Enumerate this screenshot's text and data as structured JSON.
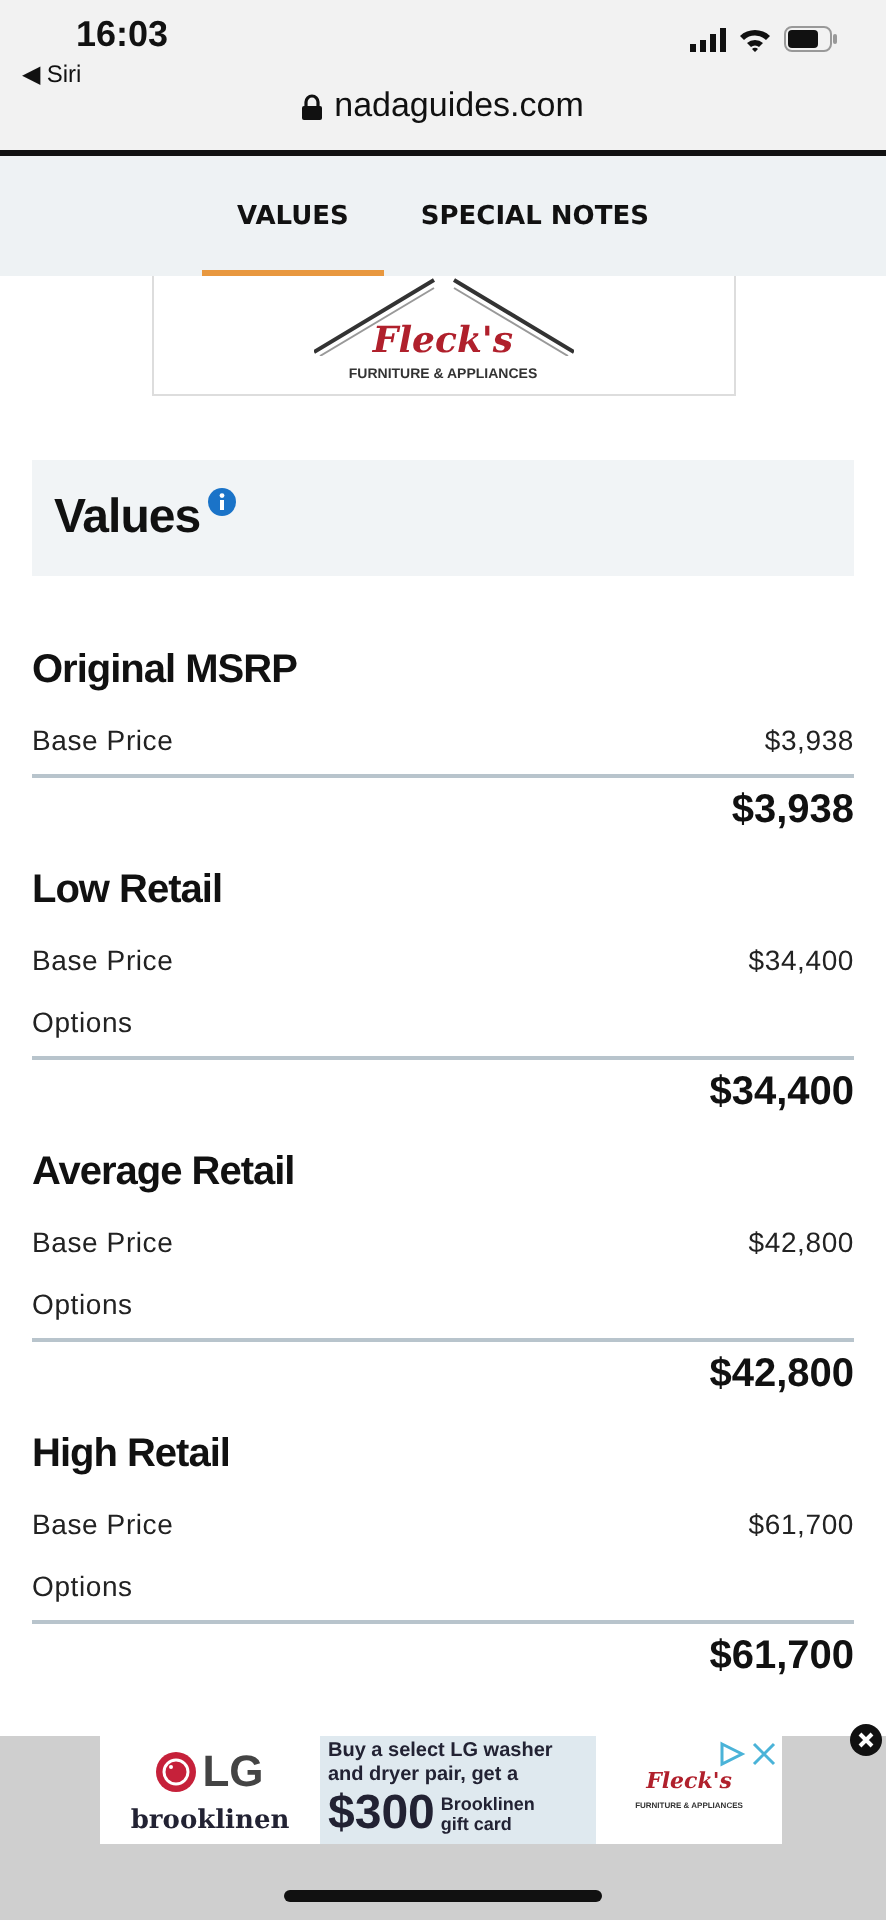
{
  "status_bar": {
    "time": "16:03",
    "back_label": "◀ Siri",
    "url": "nadaguides.com"
  },
  "tabs": [
    {
      "label": "VALUES",
      "selected": true
    },
    {
      "label": "SPECIAL NOTES",
      "selected": false
    }
  ],
  "top_ad": {
    "brand": "Fleck's",
    "tagline": "FURNITURE & APPLIANCES"
  },
  "values_header": {
    "title": "Values"
  },
  "sections": [
    {
      "title": "Original MSRP",
      "rows": [
        {
          "label": "Base Price",
          "value": "$3,938"
        }
      ],
      "total": "$3,938"
    },
    {
      "title": "Low Retail",
      "rows": [
        {
          "label": "Base Price",
          "value": "$34,400"
        },
        {
          "label": "Options"
        }
      ],
      "total": "$34,400"
    },
    {
      "title": "Average Retail",
      "rows": [
        {
          "label": "Base Price",
          "value": "$42,800"
        },
        {
          "label": "Options"
        }
      ],
      "total": "$42,800"
    },
    {
      "title": "High Retail",
      "rows": [
        {
          "label": "Base Price",
          "value": "$61,700"
        },
        {
          "label": "Options"
        }
      ],
      "total": "$61,700"
    }
  ],
  "bottom_ad": {
    "logo": "LG",
    "partner": "brooklinen",
    "offer": "Buy a select LG washer and dryer pair, get a",
    "amount": "$300",
    "gift": "Brooklinen gift card",
    "brand": "Fleck's",
    "tagline": "FURNITURE & APPLIANCES"
  }
}
